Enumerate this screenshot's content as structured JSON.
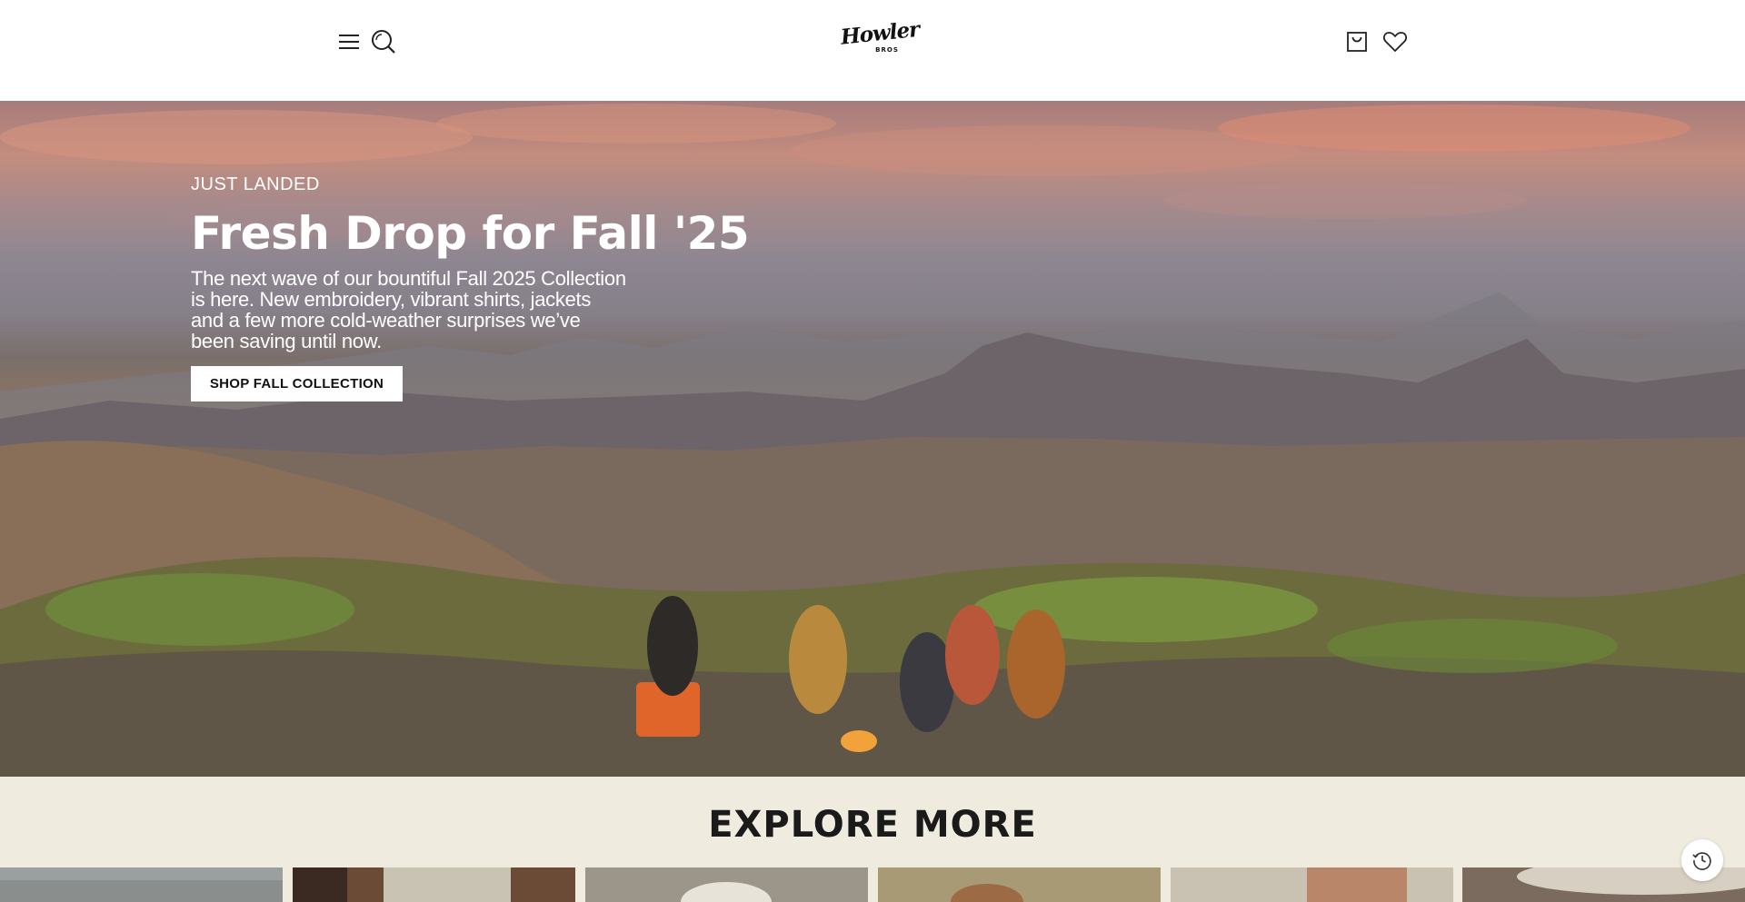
{
  "header": {
    "menu_icon": "hamburger-menu-icon",
    "search_icon": "search-icon",
    "logo": {
      "main": "Howler",
      "sub": "BROS"
    },
    "cart_icon": "shopping-bag-icon",
    "wishlist_icon": "heart-icon"
  },
  "hero": {
    "eyebrow": "JUST LANDED",
    "title": "Fresh Drop for Fall '25",
    "description": "The next wave of our bountiful Fall 2025 Collection is here. New embroidery, vibrant shirts, jackets and a few more cold-weather surprises we’ve been saving until now.",
    "cta_label": "SHOP FALL COLLECTION",
    "text_color": "#ffffff",
    "cta_background": "#ffffff"
  },
  "explore": {
    "title": "EXPLORE MORE",
    "background": "#f0ebdf",
    "tiles": [
      {
        "name": "explore-tile-1",
        "color": "#8a8e8c"
      },
      {
        "name": "explore-tile-2",
        "color": "#6b4a36"
      },
      {
        "name": "explore-tile-3",
        "color": "#9b958a"
      },
      {
        "name": "explore-tile-4",
        "color": "#a89a74"
      },
      {
        "name": "explore-tile-5",
        "color": "#b9866a"
      },
      {
        "name": "explore-tile-6",
        "color": "#7b6b5f"
      }
    ]
  },
  "floating": {
    "history_icon": "history-clock-icon"
  }
}
